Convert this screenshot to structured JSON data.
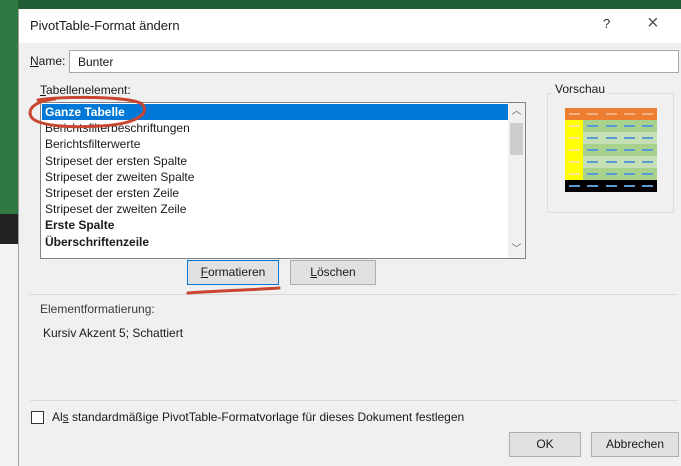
{
  "dialog": {
    "title": "PivotTable-Format ändern",
    "help_glyph": "?",
    "close_glyph": "×"
  },
  "name_field": {
    "label_prefix": "N",
    "label_rest": "ame:",
    "value": "Bunter"
  },
  "table_element": {
    "label_prefix": "T",
    "label_rest": "abellenelement:",
    "items": [
      "Ganze Tabelle",
      "Berichtsfilterbeschriftungen",
      "Berichtsfilterwerte",
      "Stripeset der ersten Spalte",
      "Stripeset der zweiten Spalte",
      "Stripeset der ersten Zeile",
      "Stripeset der zweiten Zeile",
      "Erste Spalte",
      "Überschriftenzeile"
    ],
    "selected_index": 0,
    "bold_indices": [
      0,
      7,
      8
    ]
  },
  "buttons": {
    "format_prefix": "F",
    "format_rest": "ormatieren",
    "delete_prefix": "L",
    "delete_rest": "öschen",
    "ok": "OK",
    "cancel": "Abbrechen"
  },
  "preview": {
    "label": "Vorschau",
    "colors": {
      "header": "#ed7d31",
      "first_column": "#ffff00",
      "stripe_a": "#a9d18e",
      "stripe_b": "#c5e0b4",
      "total": "#000000",
      "dash": "#5b9bd5"
    }
  },
  "element_format": {
    "label": "Elementformatierung:",
    "value": "Kursiv Akzent 5; Schattiert"
  },
  "default_checkbox": {
    "label_a": "Al",
    "label_key": "s",
    "label_b": " standardmäßige PivotTable-Formatvorlage für dieses Dokument festlegen",
    "checked": false
  },
  "colors": {
    "selection": "#0078d7",
    "annotation": "#c8462f"
  }
}
